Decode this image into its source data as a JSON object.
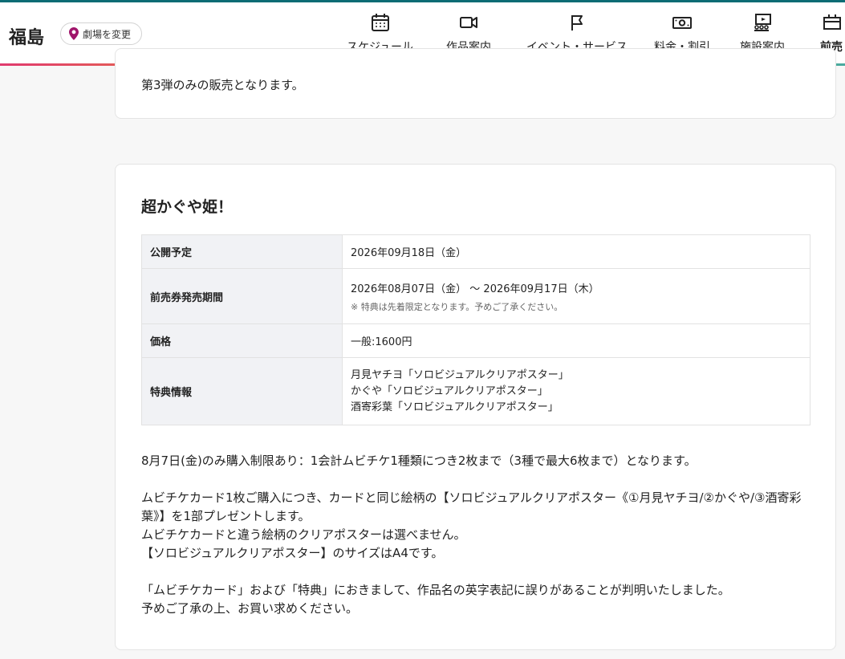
{
  "header": {
    "city": "福島",
    "change_theater_label": "劇場を変更",
    "nav": [
      {
        "label": "スケジュール",
        "icon": "calendar-icon"
      },
      {
        "label": "作品案内",
        "icon": "video-camera-icon"
      },
      {
        "label": "イベント・サービス",
        "icon": "flag-icon"
      },
      {
        "label": "料金・割引",
        "icon": "money-icon"
      },
      {
        "label": "施設案内",
        "icon": "theater-seats-icon"
      },
      {
        "label": "前売",
        "icon": "ticket-booth-icon"
      }
    ]
  },
  "prev_card": {
    "text": "第3弾のみの販売となります。"
  },
  "card": {
    "title": "超かぐや姫！",
    "rows": {
      "release": {
        "label": "公開予定",
        "value": "2026年09月18日（金）"
      },
      "period": {
        "label": "前売券発売期間",
        "value": "2026年08月07日（金） 〜 2026年09月17日（木）",
        "note": "※ 特典は先着限定となります。予めご了承ください。"
      },
      "price": {
        "label": "価格",
        "value": "一般:1600円"
      },
      "perks": {
        "label": "特典情報",
        "lines": [
          "月見ヤチヨ「ソロビジュアルクリアポスター」",
          "かぐや「ソロビジュアルクリアポスター」",
          "酒寄彩葉「ソロビジュアルクリアポスター」"
        ]
      }
    },
    "body": {
      "p1": "8月7日(金)のみ購入制限あり：1会計ムビチケ1種類につき2枚まで（3種で最大6枚まで）となります。",
      "p2a": "ムビチケカード1枚ご購入につき、カードと同じ絵柄の【ソロビジュアルクリアポスター《①月見ヤチヨ/②かぐや/③酒寄彩葉》】を1部プレゼントします。",
      "p2b": "ムビチケカードと違う絵柄のクリアポスターは選べません。",
      "p2c": "【ソロビジュアルクリアポスター】のサイズはA4です。",
      "p3a": "「ムビチケカード」および「特典」におきまして、作品名の英字表記に誤りがあることが判明いたしました。",
      "p3b": "予めご了承の上、お買い求めください。"
    }
  }
}
